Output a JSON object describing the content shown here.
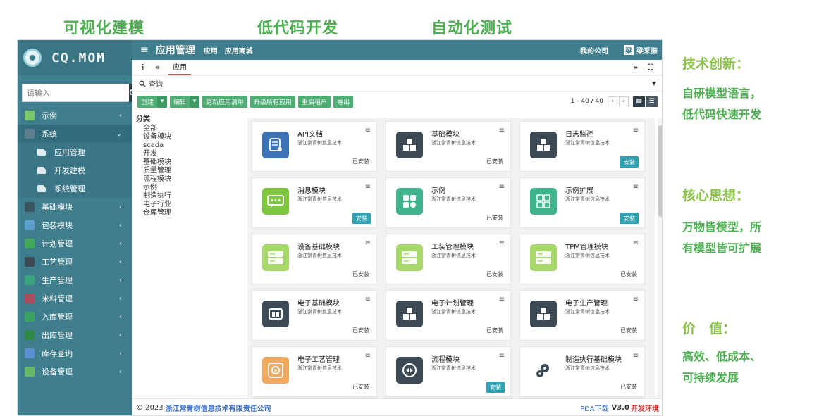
{
  "headings": {
    "left": "可视化建模",
    "middle": "低代码开发",
    "right": "自动化测试"
  },
  "brand": {
    "name": "CQ.MOM",
    "logo_icon": "cq-logo-icon"
  },
  "sidebar": {
    "search_placeholder": "请输入",
    "items": [
      {
        "label": "示例",
        "color": "#7cc66a"
      },
      {
        "label": "系统",
        "color": "#5d7f8d",
        "expanded": true
      },
      {
        "label": "应用管理",
        "sub": true
      },
      {
        "label": "开发建模",
        "sub": true
      },
      {
        "label": "系统管理",
        "sub": true
      },
      {
        "label": "基础模块",
        "color": "#3b5560"
      },
      {
        "label": "包装模块",
        "color": "#5aa0cf"
      },
      {
        "label": "计划管理",
        "color": "#42a85a"
      },
      {
        "label": "工艺管理",
        "color": "#3b4a55"
      },
      {
        "label": "生产管理",
        "color": "#39a37a"
      },
      {
        "label": "来料管理",
        "color": "#a84b5a"
      },
      {
        "label": "入库管理",
        "color": "#3aa35f"
      },
      {
        "label": "出库管理",
        "color": "#2f8a4a"
      },
      {
        "label": "库存查询",
        "color": "#5a8fd1"
      },
      {
        "label": "设备管理",
        "color": "#67b96a"
      }
    ]
  },
  "topbar": {
    "title": "应用管理",
    "nav": [
      "应用",
      "应用商城"
    ],
    "company": "我的公司",
    "user_avatar": "梁",
    "user_name": "梁采振"
  },
  "tabbar": {
    "ctrl_more": "⋮",
    "ctrl_back": "«",
    "active_tab": "应用",
    "ctrl_forward": "»",
    "ctrl_expand": "⛶"
  },
  "query": {
    "label": "查询"
  },
  "toolbar": {
    "buttons": [
      "创建",
      "编辑",
      "更新应用清单",
      "升级所有应用",
      "重启租户",
      "导出"
    ],
    "pagination": "1 - 40 / 40"
  },
  "categories": {
    "title": "分类",
    "items": [
      "全部",
      "设备模块",
      "scada",
      "开发",
      "基础模块",
      "质量管理",
      "流程模块",
      "示例",
      "制造执行",
      "电子行业",
      "仓库管理"
    ]
  },
  "cards": [
    {
      "name": "API文档",
      "company": "浙江常青树信息技术",
      "status": "已安装",
      "installed": true,
      "icon": "api-doc-icon",
      "color": "#3d73b5"
    },
    {
      "name": "基础模块",
      "company": "浙江常青树信息技术",
      "status": "已安装",
      "installed": true,
      "icon": "cubes-icon",
      "color": "#3b4a55"
    },
    {
      "name": "日志监控",
      "company": "浙江常青树信息技术",
      "status": "安装",
      "installed": false,
      "icon": "cubes-icon",
      "color": "#3b4a55"
    },
    {
      "name": "消息模块",
      "company": "浙江常青树信息技术",
      "status": "安装",
      "installed": false,
      "icon": "message-icon",
      "color": "#7cc53c"
    },
    {
      "name": "示例",
      "company": "浙江常青树信息技术",
      "status": "已安装",
      "installed": true,
      "icon": "example-icon",
      "color": "#3fb38a"
    },
    {
      "name": "示例扩展",
      "company": "浙江常青树信息技术",
      "status": "安装",
      "installed": false,
      "icon": "extension-icon",
      "color": "#3fb38a"
    },
    {
      "name": "设备基础模块",
      "company": "浙江常青树信息技术",
      "status": "已安装",
      "installed": true,
      "icon": "server-icon",
      "color": "#a7d96a"
    },
    {
      "name": "工装管理模块",
      "company": "浙江常青树信息技术",
      "status": "已安装",
      "installed": true,
      "icon": "server-icon",
      "color": "#a7d96a"
    },
    {
      "name": "TPM管理模块",
      "company": "浙江常青树信息技术",
      "status": "已安装",
      "installed": true,
      "icon": "server-icon",
      "color": "#a7d96a"
    },
    {
      "name": "电子基础模块",
      "company": "浙江常青树信息技术",
      "status": "已安装",
      "installed": true,
      "icon": "chip-icon",
      "color": "#3b4a55"
    },
    {
      "name": "电子计划管理",
      "company": "浙江常青树信息技术",
      "status": "已安装",
      "installed": true,
      "icon": "cubes-icon",
      "color": "#3b4a55"
    },
    {
      "name": "电子生产管理",
      "company": "浙江常青树信息技术",
      "status": "已安装",
      "installed": true,
      "icon": "cubes-icon",
      "color": "#3b4a55"
    },
    {
      "name": "电子工艺管理",
      "company": "浙江常青树信息技术",
      "status": "已安装",
      "installed": true,
      "icon": "gear-box-icon",
      "color": "#f1a95f"
    },
    {
      "name": "流程模块",
      "company": "浙江常青树信息技术",
      "status": "安装",
      "installed": false,
      "icon": "flow-icon",
      "color": "#3b4a55"
    },
    {
      "name": "制造执行基础模块",
      "company": "浙江常青树信息技术",
      "status": "已安装",
      "installed": true,
      "icon": "gears-icon",
      "color": "#ffffff"
    }
  ],
  "footer": {
    "copyright": "© 2023",
    "company": "浙江常青树信息技术有限责任公司",
    "pda": "PDA下载",
    "version": "V3.0",
    "env": "开发环境"
  },
  "right_panel": {
    "sections": [
      {
        "heading": "技术创新：",
        "lines": [
          "自研模型语言，",
          "低代码快速开发"
        ]
      },
      {
        "heading": "核心思想：",
        "lines": [
          "万物皆模型，所",
          "有模型皆可扩展"
        ]
      },
      {
        "heading": "价　值：",
        "lines": [
          "高效、低成本、",
          "可持续发展"
        ]
      }
    ]
  }
}
